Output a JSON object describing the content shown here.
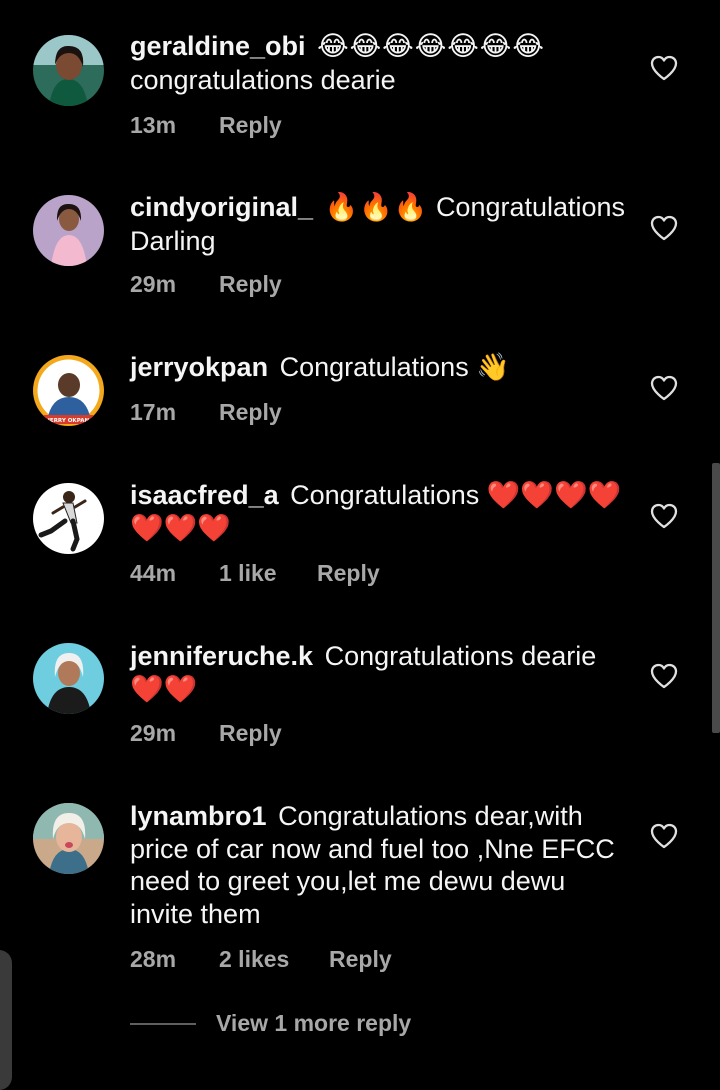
{
  "comments": [
    {
      "username": "geraldine_obi",
      "emoji": "😂😂😂😂😂😂😂",
      "text": "congratulations dearie",
      "time": "13m",
      "likes": "",
      "reply": "Reply",
      "avatar_icon": "avatar-woman-green-dress"
    },
    {
      "username": "cindyoriginal_",
      "emoji": "🔥🔥🔥",
      "text": "Congratulations Darling",
      "time": "29m",
      "likes": "",
      "reply": "Reply",
      "avatar_icon": "avatar-woman-pink-dress"
    },
    {
      "username": "jerryokpan",
      "emoji": "",
      "text": "Congratulations 👋",
      "time": "17m",
      "likes": "",
      "reply": "Reply",
      "avatar_icon": "avatar-jerry-okpan-logo",
      "avatar_caption": "JERRY OKPAN"
    },
    {
      "username": "isaacfred_a",
      "emoji": "",
      "text": "Congratulations ❤️❤️❤️❤️ ❤️❤️❤️",
      "time": "44m",
      "likes": "1 like",
      "reply": "Reply",
      "avatar_icon": "avatar-man-dancing"
    },
    {
      "username": "jenniferuche.k",
      "emoji": "",
      "text": "Congratulations dearie ❤️❤️",
      "time": "29m",
      "likes": "",
      "reply": "Reply",
      "avatar_icon": "avatar-woman-white-hair"
    },
    {
      "username": "lynambro1",
      "emoji": "",
      "text": "Congratulations dear,with price of car now and fuel too ,Nne EFCC need to greet you,let me dewu dewu invite them",
      "time": "28m",
      "likes": "2 likes",
      "reply": "Reply",
      "avatar_icon": "avatar-woman-selfie"
    }
  ],
  "view_more": "View 1 more reply",
  "icons": {
    "like": "heart-outline-icon"
  },
  "colors": {
    "background": "#000000",
    "primary_text": "#f5f5f5",
    "secondary_text": "#a8a8a8"
  }
}
